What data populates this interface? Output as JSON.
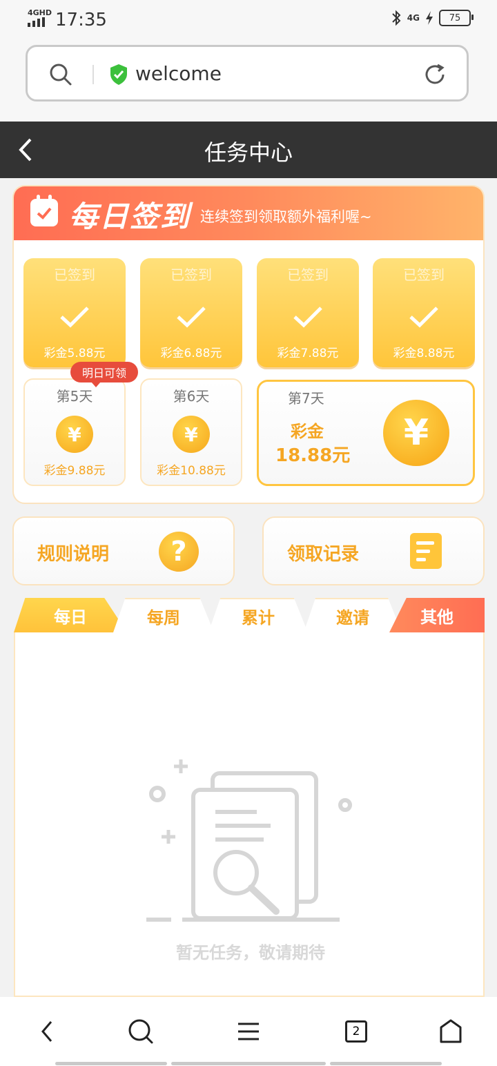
{
  "status_bar": {
    "network": "4GHD",
    "time": "17:35",
    "signal_right": "4G",
    "battery": "75"
  },
  "url_bar": {
    "url": "welcome"
  },
  "header": {
    "title": "任务中心"
  },
  "signin": {
    "title": "每日签到",
    "subtitle": "连续签到领取额外福利喔~",
    "signed": [
      {
        "label": "已签到",
        "amount": "彩金5.88元"
      },
      {
        "label": "已签到",
        "amount": "彩金6.88元"
      },
      {
        "label": "已签到",
        "amount": "彩金7.88元"
      },
      {
        "label": "已签到",
        "amount": "彩金8.88元"
      }
    ],
    "upcoming": [
      {
        "label": "第5天",
        "amount": "彩金9.88元",
        "badge": "明日可领",
        "coin": "¥"
      },
      {
        "label": "第6天",
        "amount": "彩金10.88元",
        "coin": "¥"
      }
    ],
    "day7": {
      "label": "第7天",
      "line1": "彩金",
      "line2": "18.88元",
      "coin": "¥"
    }
  },
  "actions": {
    "rules": "规则说明",
    "rules_icon": "?",
    "records": "领取记录"
  },
  "tabs": [
    "每日",
    "每周",
    "累计",
    "邀请",
    "其他"
  ],
  "active_tab": "每日",
  "empty_message": "暂无任务，敬请期待",
  "bottom_nav": {
    "tabs_count": "2"
  },
  "colors": {
    "accent": "#f5a623",
    "header_bg": "#333333",
    "badge": "#e74c3c",
    "banner_start": "#ff6d53",
    "banner_end": "#ffb46a"
  }
}
